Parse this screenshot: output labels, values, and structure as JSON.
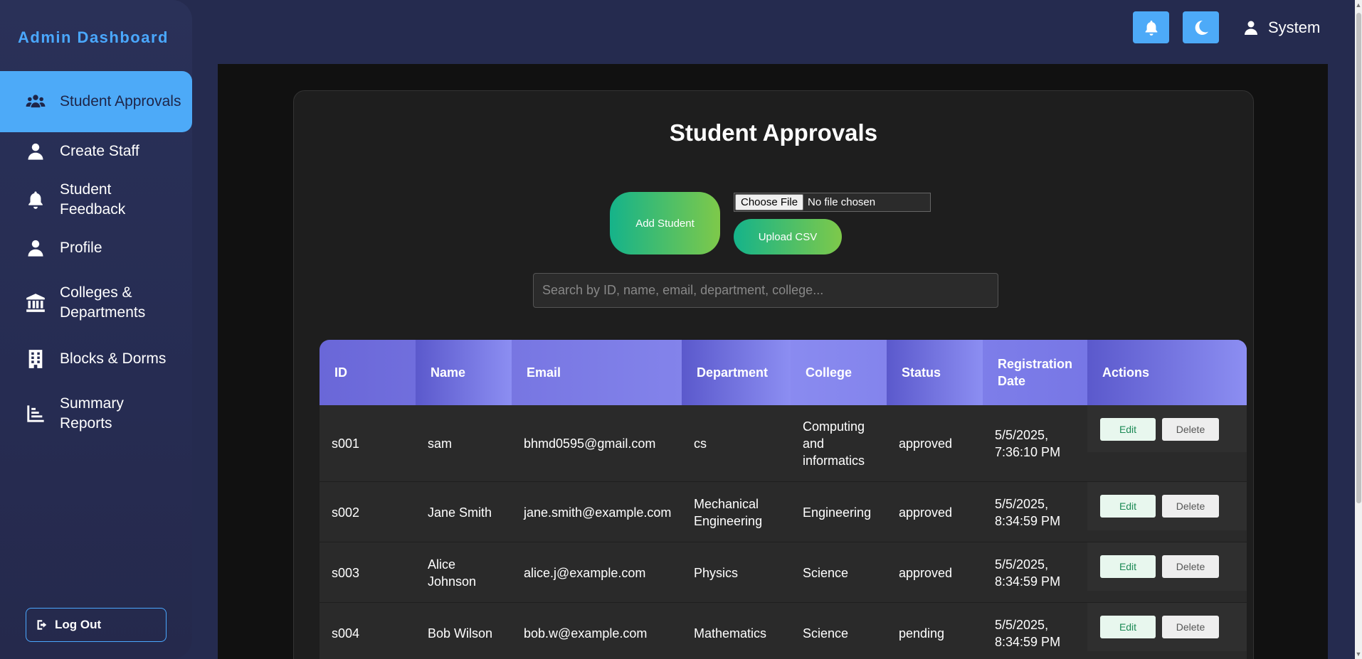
{
  "sidebar": {
    "brand": "Admin Dashboard",
    "items": [
      {
        "label": "Student Approvals",
        "icon": "users-icon",
        "active": true
      },
      {
        "label": "Create Staff",
        "icon": "user-icon"
      },
      {
        "label": "Student Feedback",
        "icon": "bell-icon"
      },
      {
        "label": "Profile",
        "icon": "user-icon"
      },
      {
        "label": "Colleges & Departments",
        "icon": "university-icon"
      },
      {
        "label": "Blocks & Dorms",
        "icon": "building-icon"
      },
      {
        "label": "Summary Reports",
        "icon": "chart-icon"
      }
    ],
    "logout_label": "Log Out"
  },
  "topbar": {
    "user_label": "System",
    "accent": "#4daaf8"
  },
  "main": {
    "title": "Student Approvals",
    "add_student_label": "Add Student",
    "choose_file_label": "Choose File",
    "file_status": "No file chosen",
    "upload_csv_label": "Upload CSV",
    "search_placeholder": "Search by ID, name, email, department, college...",
    "search_value": ""
  },
  "table": {
    "columns": [
      "ID",
      "Name",
      "Email",
      "Department",
      "College",
      "Status",
      "Registration Date",
      "Actions"
    ],
    "edit_label": "Edit",
    "delete_label": "Delete",
    "rows": [
      {
        "id": "s001",
        "name": "sam",
        "email": "bhmd0595@gmail.com",
        "department": "cs",
        "college": "Computing and informatics",
        "status": "approved",
        "date": "5/5/2025, 7:36:10 PM"
      },
      {
        "id": "s002",
        "name": "Jane Smith",
        "email": "jane.smith@example.com",
        "department": "Mechanical Engineering",
        "college": "Engineering",
        "status": "approved",
        "date": "5/5/2025, 8:34:59 PM"
      },
      {
        "id": "s003",
        "name": "Alice Johnson",
        "email": "alice.j@example.com",
        "department": "Physics",
        "college": "Science",
        "status": "approved",
        "date": "5/5/2025, 8:34:59 PM"
      },
      {
        "id": "s004",
        "name": "Bob Wilson",
        "email": "bob.w@example.com",
        "department": "Mathematics",
        "college": "Science",
        "status": "pending",
        "date": "5/5/2025, 8:34:59 PM"
      }
    ]
  }
}
